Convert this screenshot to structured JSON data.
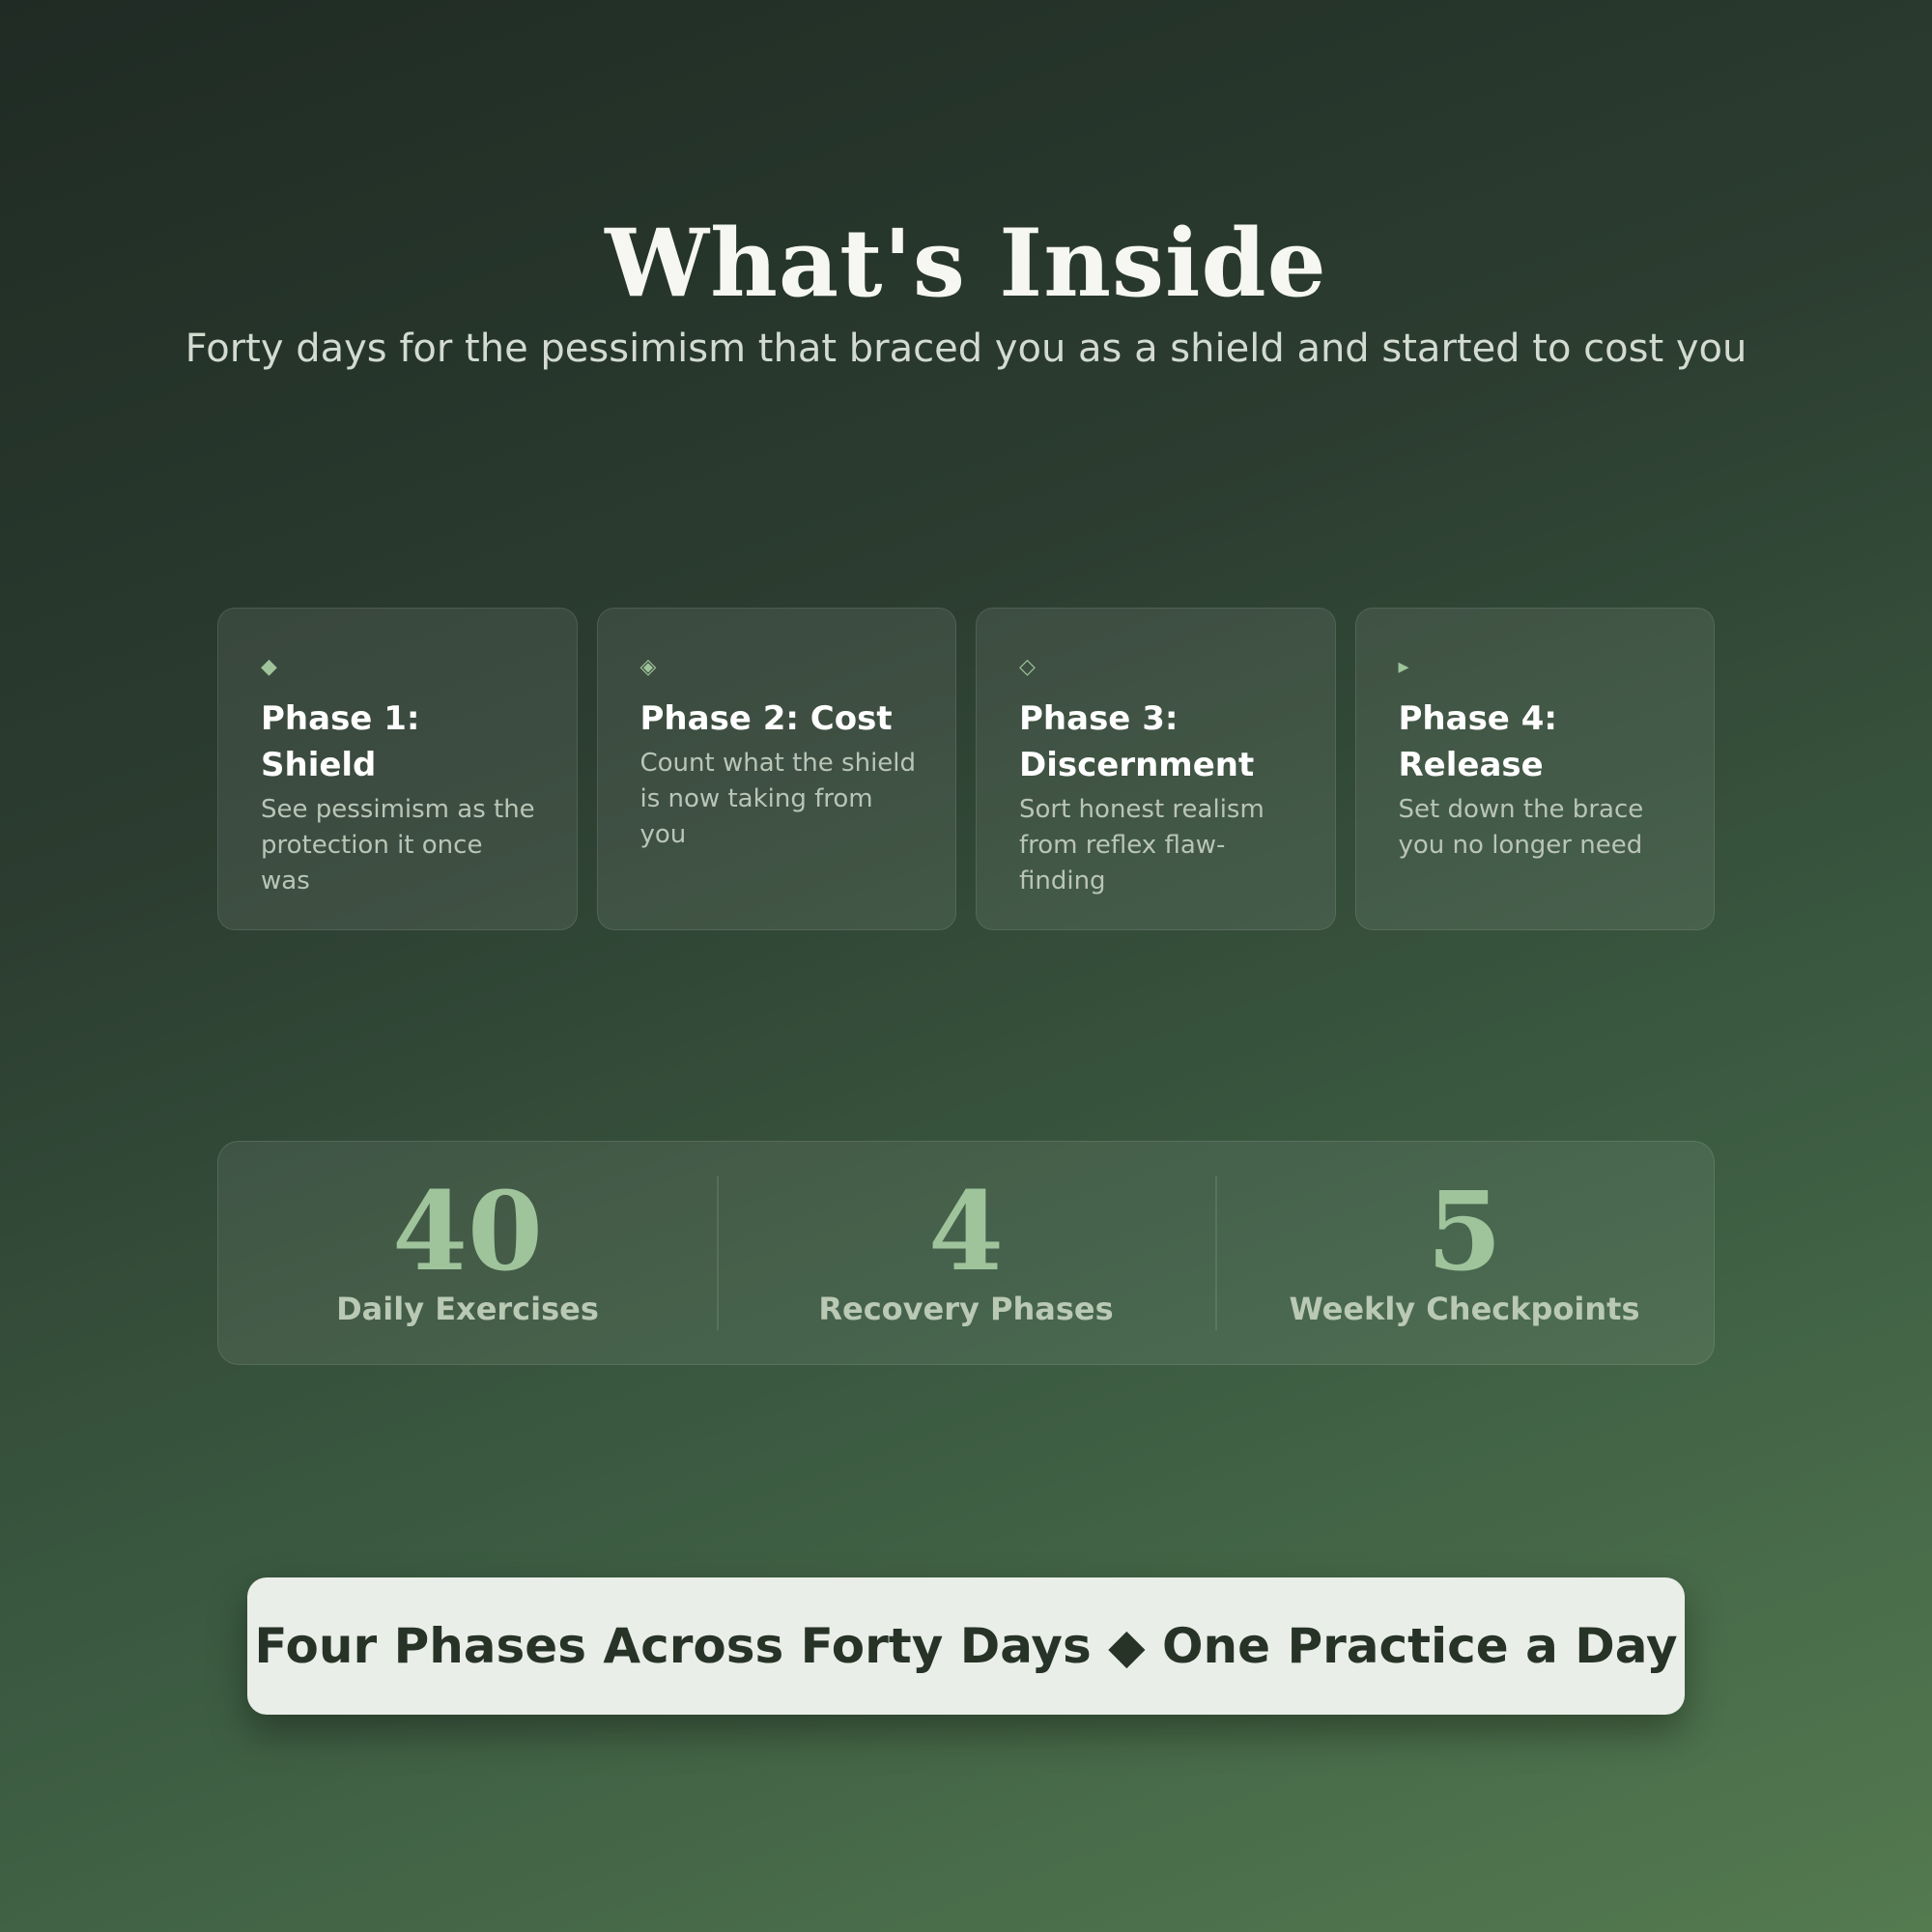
{
  "header": {
    "title": "What's Inside",
    "subtitle": "Forty days for the pessimism that braced you as a shield and started to cost you"
  },
  "phases": [
    {
      "icon": "◆",
      "icon_name": "filled-diamond-icon",
      "title": "Phase 1: Shield",
      "description": "See pessimism as the protection it once was"
    },
    {
      "icon": "◈",
      "icon_name": "diamond-dot-icon",
      "title": "Phase 2: Cost",
      "description": "Count what the shield is now taking from you"
    },
    {
      "icon": "◇",
      "icon_name": "outline-diamond-icon",
      "title": "Phase 3: Discernment",
      "description": "Sort honest realism from reflex flaw-finding"
    },
    {
      "icon": "▸",
      "icon_name": "right-triangle-icon",
      "title": "Phase 4: Release",
      "description": "Set down the brace you no longer need"
    }
  ],
  "stats": [
    {
      "value": "40",
      "label": "Daily Exercises"
    },
    {
      "value": "4",
      "label": "Recovery Phases"
    },
    {
      "value": "5",
      "label": "Weekly Checkpoints"
    }
  ],
  "banner": {
    "text": "Four Phases Across Forty Days ◆ One Practice a Day"
  },
  "colors": {
    "accent": "#9fc49b",
    "background_top": "#1f2b24",
    "background_bottom": "#547a50",
    "banner_background": "#eaeee8",
    "banner_text": "#283328"
  }
}
